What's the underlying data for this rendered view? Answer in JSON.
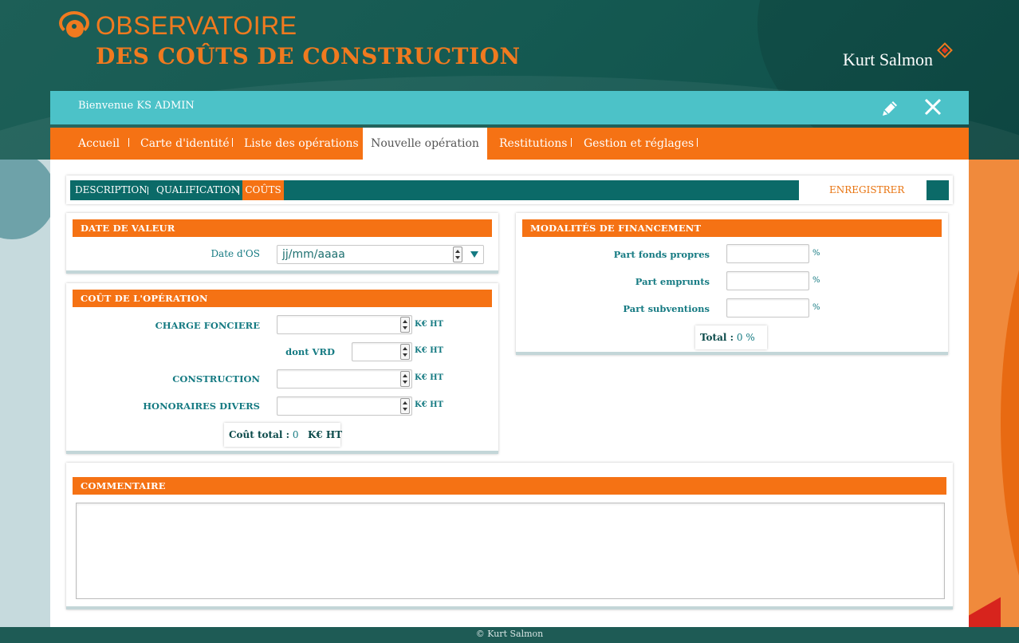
{
  "header": {
    "logo_line1": "OBSERVATOIRE",
    "logo_line2": "DES COÛTS DE CONSTRUCTION",
    "brand": "Kurt Salmon"
  },
  "welcome": {
    "text": "Bienvenue KS ADMIN"
  },
  "nav": {
    "items": [
      {
        "label": "Accueil"
      },
      {
        "label": "Carte d'identité"
      },
      {
        "label": "Liste des opérations"
      },
      {
        "label": "Nouvelle opération"
      },
      {
        "label": "Restitutions"
      },
      {
        "label": "Gestion et réglages"
      }
    ],
    "active": "Nouvelle opération"
  },
  "subtabs": {
    "items": [
      {
        "label": "DESCRIPTION"
      },
      {
        "label": "QUALIFICATION"
      },
      {
        "label": "COÛTS"
      }
    ],
    "active": "COÛTS",
    "save_label": "ENREGISTRER"
  },
  "date_panel": {
    "title": "DATE DE VALEUR",
    "date_label": "Date d'OS",
    "date_placeholder": "jj/mm/aaaa"
  },
  "cost_panel": {
    "title": "COÛT DE L'OPÉRATION",
    "fields": [
      {
        "label": "CHARGE FONCIERE",
        "unit": "K€ HT",
        "value": ""
      },
      {
        "label": "dont VRD",
        "unit": "K€ HT",
        "value": ""
      },
      {
        "label": "CONSTRUCTION",
        "unit": "K€ HT",
        "value": ""
      },
      {
        "label": "HONORAIRES DIVERS",
        "unit": "K€ HT",
        "value": ""
      }
    ],
    "total_label": "Coût total :",
    "total_value": "0",
    "total_unit": "K€ HT"
  },
  "finance_panel": {
    "title": "MODALITÉS DE FINANCEMENT",
    "fields": [
      {
        "label": "Part fonds propres",
        "unit": "%",
        "value": ""
      },
      {
        "label": "Part emprunts",
        "unit": "%",
        "value": ""
      },
      {
        "label": "Part subventions",
        "unit": "%",
        "value": ""
      }
    ],
    "total_label": "Total :",
    "total_value": "0 %"
  },
  "comment_panel": {
    "title": "COMMENTAIRE",
    "value": ""
  },
  "footer": {
    "text": "© Kurt Salmon"
  },
  "colors": {
    "orange": "#f57214",
    "teal": "#0b6a68",
    "cyan": "#4cc2c8",
    "dark": "#1e5b55"
  }
}
